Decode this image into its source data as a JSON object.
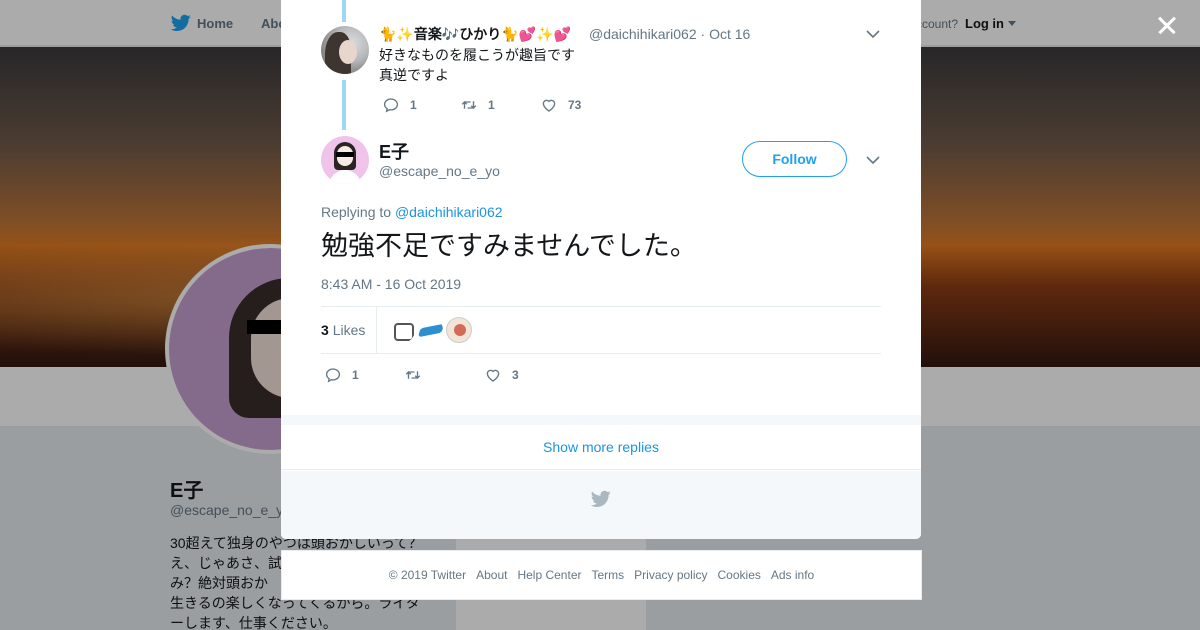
{
  "background": {
    "nav": {
      "home": "Home",
      "about": "Abo",
      "account": "ccount?",
      "login": "Log in"
    },
    "profile": {
      "name": "E子",
      "handle": "@escape_no_e_y",
      "bio": "30超えて独身のやつは頭おかしいって？え、じゃあさ、試　　　　　　　　　てみ？絶対頭おか　　　　　　　　　いて生きるの楽しくなってくるから。ライターします、仕事ください。",
      "ads_info": "Ads info"
    }
  },
  "previous_tweet": {
    "name_prefix_emoji": "🐈✨",
    "name_text": "音楽",
    "name_mid_emoji": "🎶",
    "name_text2": "ひかり",
    "name_suffix_emoji": "🐈💕✨💕",
    "handle": "@daichihikari062",
    "separator": "·",
    "date": "Oct 16",
    "text_line1": "好きなものを履こうが趣旨です",
    "text_line2": "真逆ですよ",
    "replies": "1",
    "retweets": "1",
    "likes": "73"
  },
  "main_tweet": {
    "name": "E子",
    "handle": "@escape_no_e_yo",
    "follow_label": "Follow",
    "replying_prefix": "Replying to",
    "replying_to": "@daichihikari062",
    "text": "勉強不足ですみませんでした。",
    "timestamp": "8:43 AM - 16 Oct 2019",
    "like_count": "3",
    "likes_label": "Likes",
    "replies": "1",
    "retweets": "",
    "likes": "3"
  },
  "show_more_replies": "Show more replies",
  "footer": {
    "copyright": "© 2019 Twitter",
    "about": "About",
    "help": "Help Center",
    "terms": "Terms",
    "privacy": "Privacy policy",
    "cookies": "Cookies",
    "ads": "Ads info"
  },
  "colors": {
    "accent": "#1da1f2",
    "link": "#1b95e0",
    "secondary_text": "#657786",
    "thread_line": "#9fd6f5"
  }
}
